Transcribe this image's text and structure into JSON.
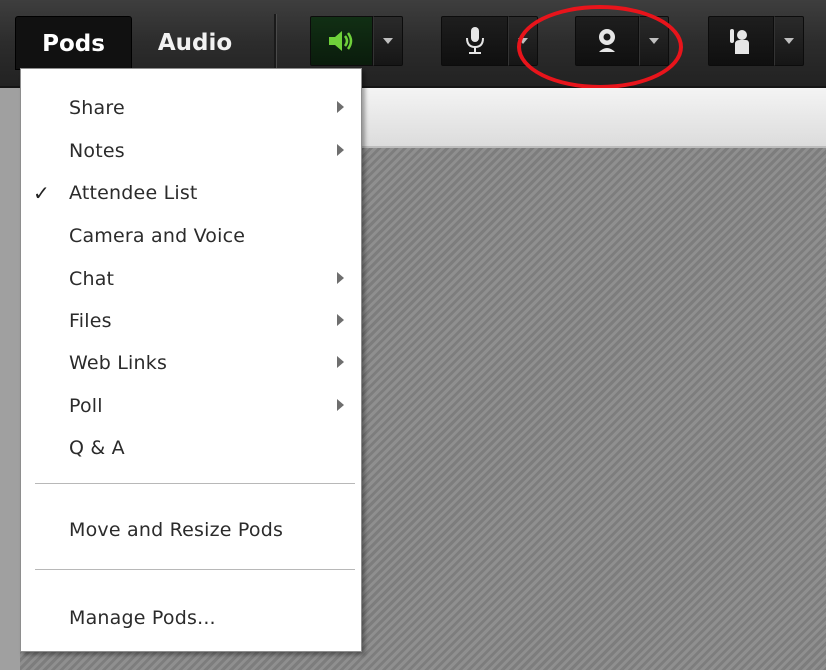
{
  "toolbar": {
    "menus": [
      {
        "label": "Pods"
      },
      {
        "label": "Audio"
      }
    ],
    "buttons": [
      {
        "name": "speaker",
        "icon": "speaker-icon"
      },
      {
        "name": "microphone",
        "icon": "microphone-icon"
      },
      {
        "name": "webcam",
        "icon": "webcam-icon"
      },
      {
        "name": "raise-hand",
        "icon": "raise-hand-icon"
      }
    ]
  },
  "pods_menu": {
    "items": [
      {
        "label": "Share",
        "submenu": true,
        "checked": false
      },
      {
        "label": "Notes",
        "submenu": true,
        "checked": false
      },
      {
        "label": "Attendee List",
        "submenu": false,
        "checked": true
      },
      {
        "label": "Camera and Voice",
        "submenu": false,
        "checked": false
      },
      {
        "label": "Chat",
        "submenu": true,
        "checked": false
      },
      {
        "label": "Files",
        "submenu": true,
        "checked": false
      },
      {
        "label": "Web Links",
        "submenu": true,
        "checked": false
      },
      {
        "label": "Poll",
        "submenu": true,
        "checked": false
      },
      {
        "label": "Q & A",
        "submenu": false,
        "checked": false
      },
      {
        "label": "Move and Resize Pods",
        "submenu": false,
        "checked": false
      },
      {
        "label": "Manage Pods...",
        "submenu": false,
        "checked": false
      }
    ],
    "check_glyph": "✓"
  },
  "colors": {
    "toolbar_bg": "#2c2c2c",
    "speaker_active": "#6fd13a",
    "highlight_ring": "#e8141b",
    "stage_stripes": "#8a8a8a"
  }
}
